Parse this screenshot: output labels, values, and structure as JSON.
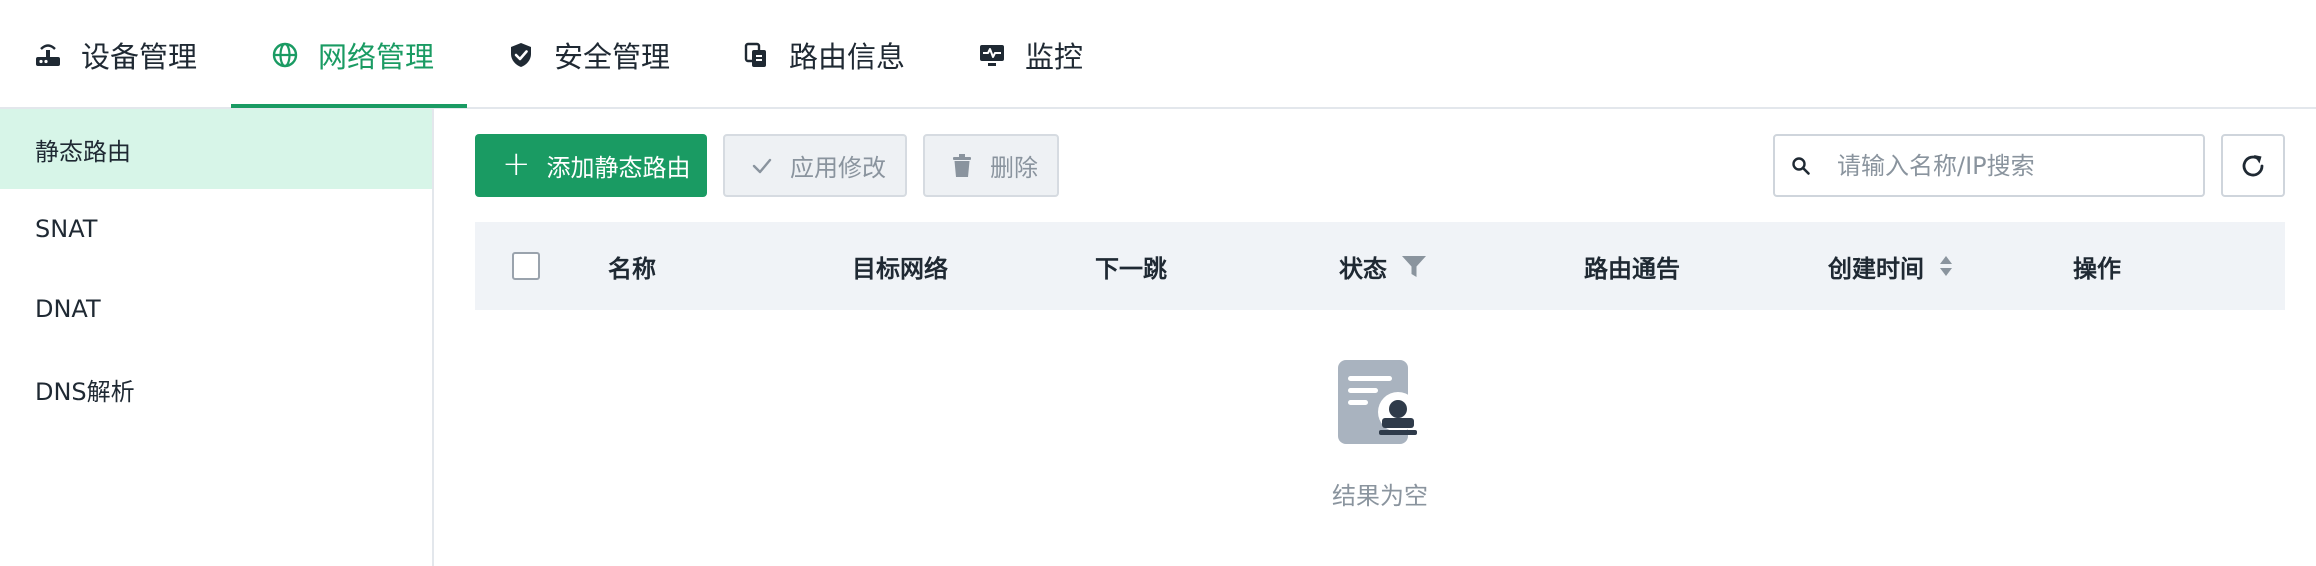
{
  "nav": {
    "tabs": [
      {
        "label": "设备管理",
        "icon": "router-icon"
      },
      {
        "label": "网络管理",
        "icon": "globe-icon",
        "active": true
      },
      {
        "label": "安全管理",
        "icon": "shield-check-icon"
      },
      {
        "label": "路由信息",
        "icon": "copy-document-icon"
      },
      {
        "label": "监控",
        "icon": "monitor-pulse-icon"
      }
    ],
    "accent_color": "#1a9b63"
  },
  "sidebar": {
    "items": [
      {
        "label": "静态路由",
        "active": true
      },
      {
        "label": "SNAT"
      },
      {
        "label": "DNAT"
      },
      {
        "label": "DNS解析"
      }
    ]
  },
  "toolbar": {
    "add_label": "添加静态路由",
    "apply_label": "应用修改",
    "delete_label": "删除",
    "search_placeholder": "请输入名称/IP搜索"
  },
  "table": {
    "columns": [
      "名称",
      "目标网络",
      "下一跳",
      "状态",
      "路由通告",
      "创建时间",
      "操作"
    ],
    "rows": []
  },
  "empty": {
    "text": "结果为空"
  }
}
